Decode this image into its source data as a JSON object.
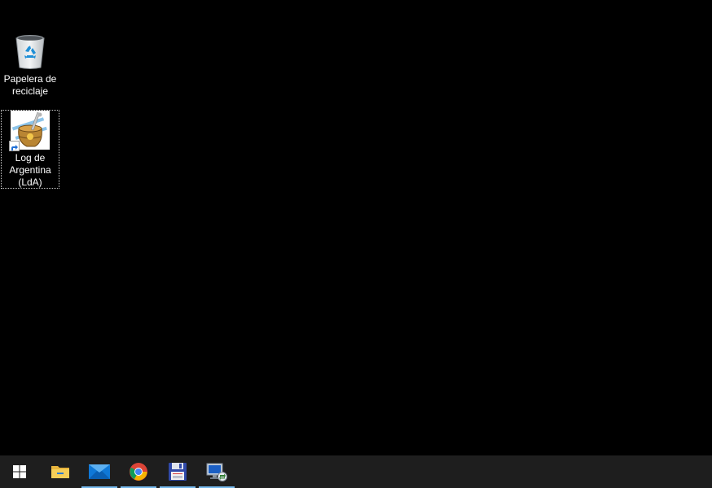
{
  "desktop": {
    "icons": [
      {
        "label": "Papelera de reciclaje",
        "icon": "recycle-bin-icon"
      },
      {
        "label": "Log de Argentina (LdA)",
        "icon": "log-de-argentina-icon",
        "selected": true,
        "shortcut": true
      }
    ]
  },
  "taskbar": {
    "items": [
      {
        "icon": "windows-start-icon",
        "open": false
      },
      {
        "icon": "file-explorer-icon",
        "open": false
      },
      {
        "icon": "mail-icon",
        "open": true
      },
      {
        "icon": "chrome-icon",
        "open": true
      },
      {
        "icon": "floppy-disk-icon",
        "open": true
      },
      {
        "icon": "remote-desktop-icon",
        "open": true
      }
    ],
    "accent": "#76b9ed",
    "background": "#1e1e1e"
  }
}
